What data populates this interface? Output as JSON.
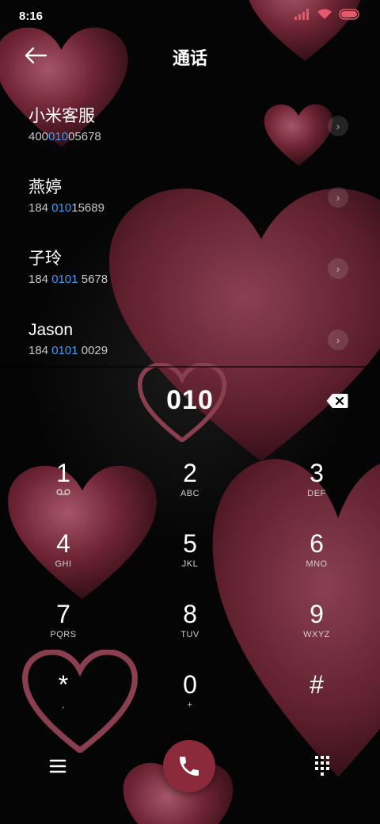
{
  "status_bar": {
    "time": "8:16"
  },
  "header": {
    "title": "通话",
    "back_icon": "arrow-left-icon"
  },
  "contacts": [
    {
      "name": "小米客服",
      "number_parts": [
        "400",
        "010",
        "05678"
      ]
    },
    {
      "name": "燕婷",
      "number_parts": [
        "184 ",
        "010",
        "15689"
      ]
    },
    {
      "name": "子玲",
      "number_parts": [
        "184 ",
        "0101",
        " 5678"
      ]
    },
    {
      "name": "Jason",
      "number_parts": [
        "184 ",
        "0101",
        " 0029"
      ]
    }
  ],
  "dialed": "010",
  "keys": [
    {
      "digit": "1",
      "letters": ""
    },
    {
      "digit": "2",
      "letters": "ABC"
    },
    {
      "digit": "3",
      "letters": "DEF"
    },
    {
      "digit": "4",
      "letters": "GHI"
    },
    {
      "digit": "5",
      "letters": "JKL"
    },
    {
      "digit": "6",
      "letters": "MNO"
    },
    {
      "digit": "7",
      "letters": "PQRS"
    },
    {
      "digit": "8",
      "letters": "TUV"
    },
    {
      "digit": "9",
      "letters": "WXYZ"
    },
    {
      "digit": "*",
      "letters": ","
    },
    {
      "digit": "0",
      "letters": "+"
    },
    {
      "digit": "#",
      "letters": ""
    }
  ],
  "colors": {
    "highlight": "#3a9ef3",
    "call_button": "#8a2a3a",
    "heart": "#7a2a38"
  }
}
